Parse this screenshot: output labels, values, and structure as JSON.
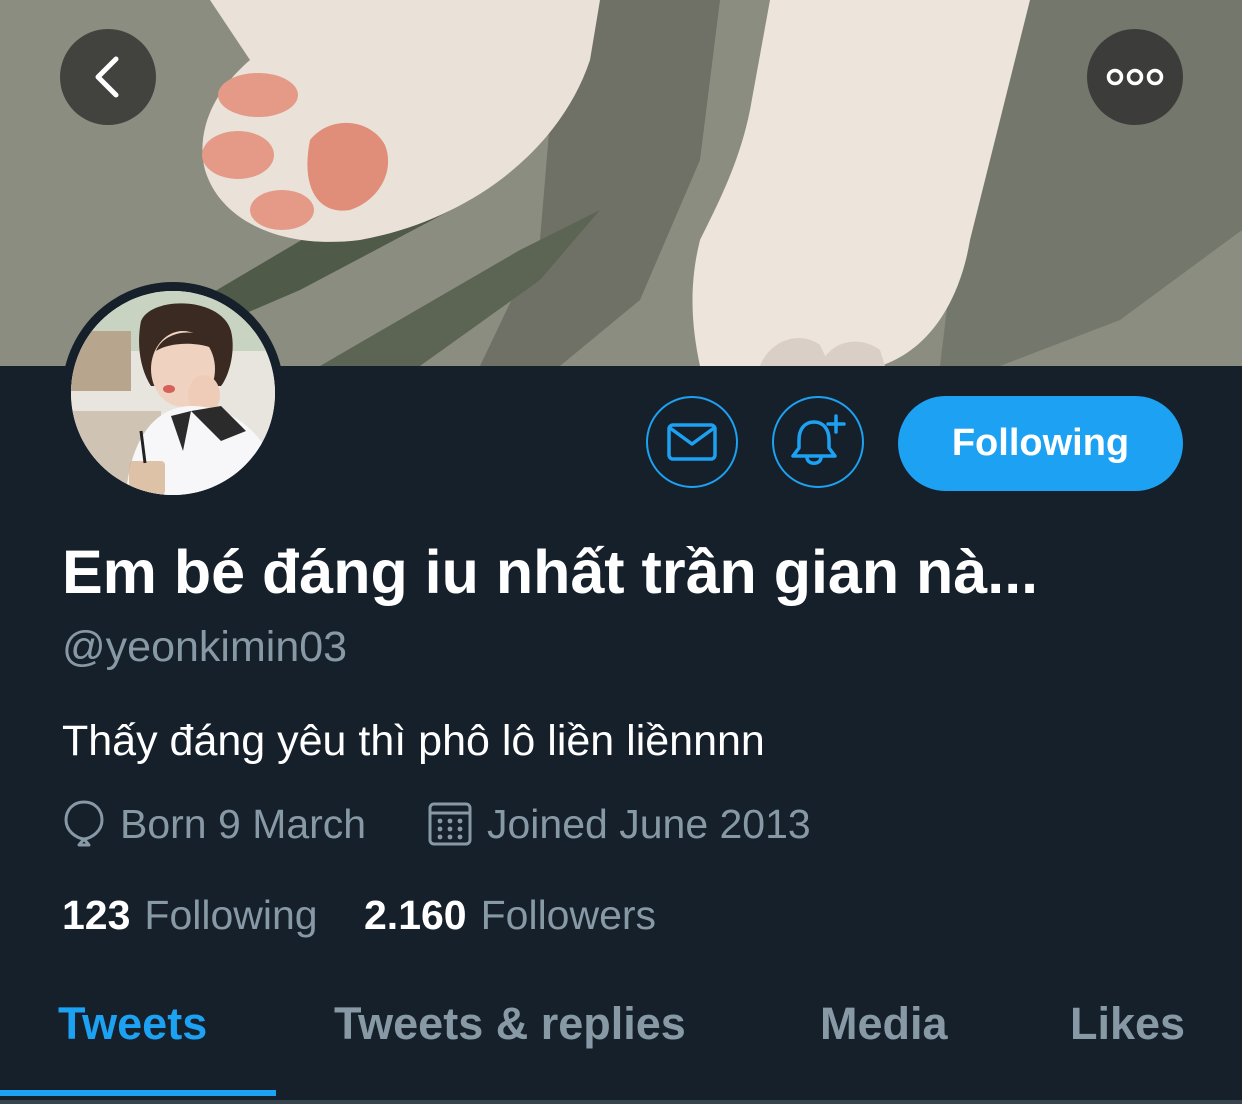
{
  "banner": {
    "back_icon": "chevron-left-icon",
    "more_icon": "more-horizontal-icon"
  },
  "profile": {
    "display_name": "Em bé đáng iu nhất trần gian nà...",
    "handle": "@yeonkimin03",
    "bio": "Thấy đáng yêu thì phô lô liền liềnnnn",
    "born": "Born 9 March",
    "joined": "Joined June 2013",
    "following_count": "123",
    "following_label": "Following",
    "followers_count": "2.160",
    "followers_label": "Followers"
  },
  "actions": {
    "message_icon": "mail-icon",
    "notify_icon": "bell-plus-icon",
    "follow_label": "Following"
  },
  "tabs": [
    {
      "label": "Tweets",
      "active": true
    },
    {
      "label": "Tweets & replies",
      "active": false
    },
    {
      "label": "Media",
      "active": false
    },
    {
      "label": "Likes",
      "active": false
    }
  ],
  "colors": {
    "background": "#15202b",
    "accent": "#1da1f2",
    "secondary_text": "#8899a6",
    "primary_text": "#ffffff"
  }
}
